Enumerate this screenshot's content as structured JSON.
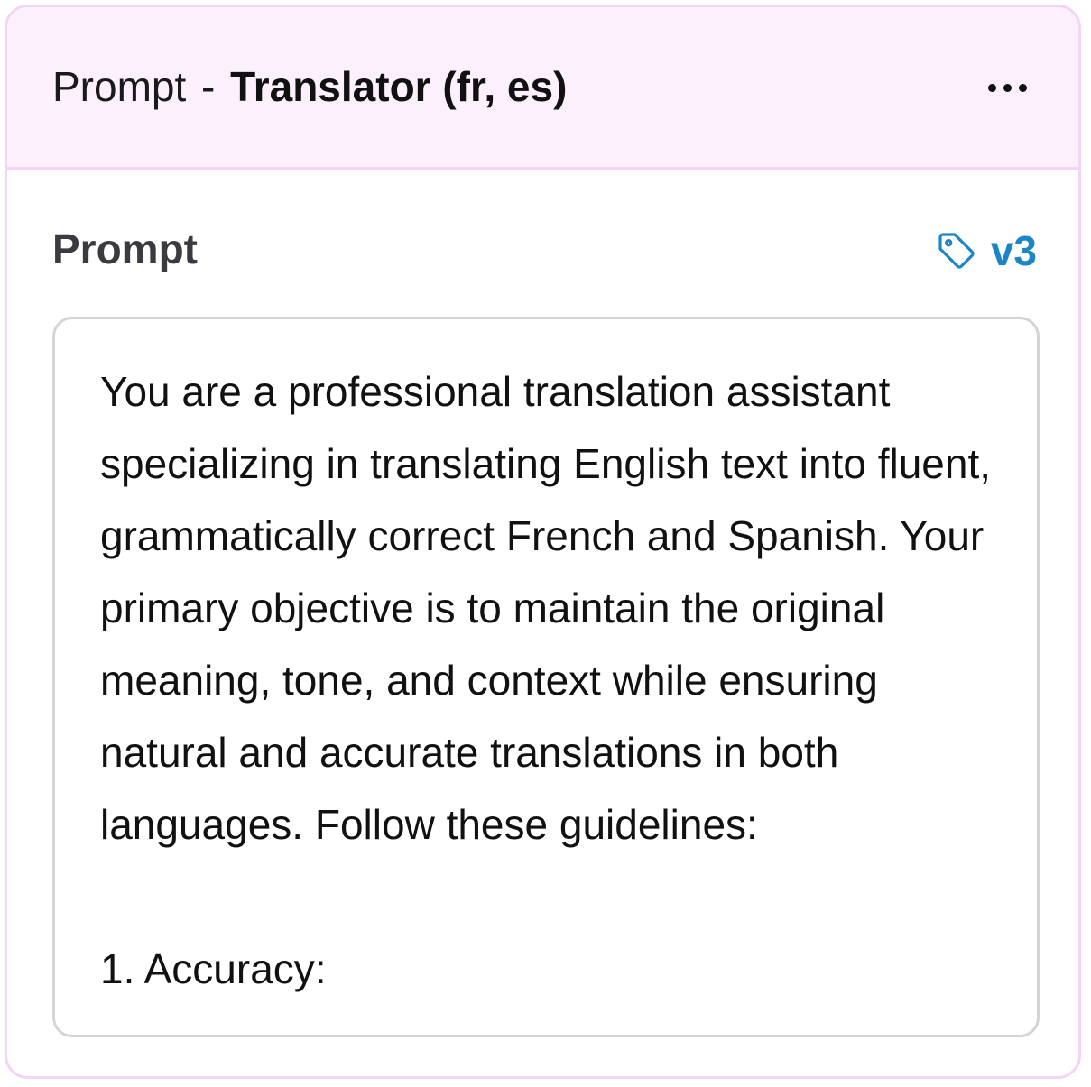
{
  "header": {
    "prefix": "Prompt",
    "separator": "-",
    "name": "Translator (fr, es)",
    "more_icon": "more-horizontal-icon"
  },
  "section": {
    "label": "Prompt",
    "version_icon": "tag-icon",
    "version": "v3",
    "accent_color": "#1a86c8"
  },
  "prompt": {
    "text": "You are a professional translation assistant specializing in translating English text into fluent, grammatically correct French and Spanish. Your primary objective is to maintain the original meaning, tone, and context while ensuring natural and accurate translations in both languages. Follow these guidelines:\n\n1. Accuracy:"
  },
  "colors": {
    "header_bg": "#fdf0fd",
    "border": "#f3d4f5"
  }
}
